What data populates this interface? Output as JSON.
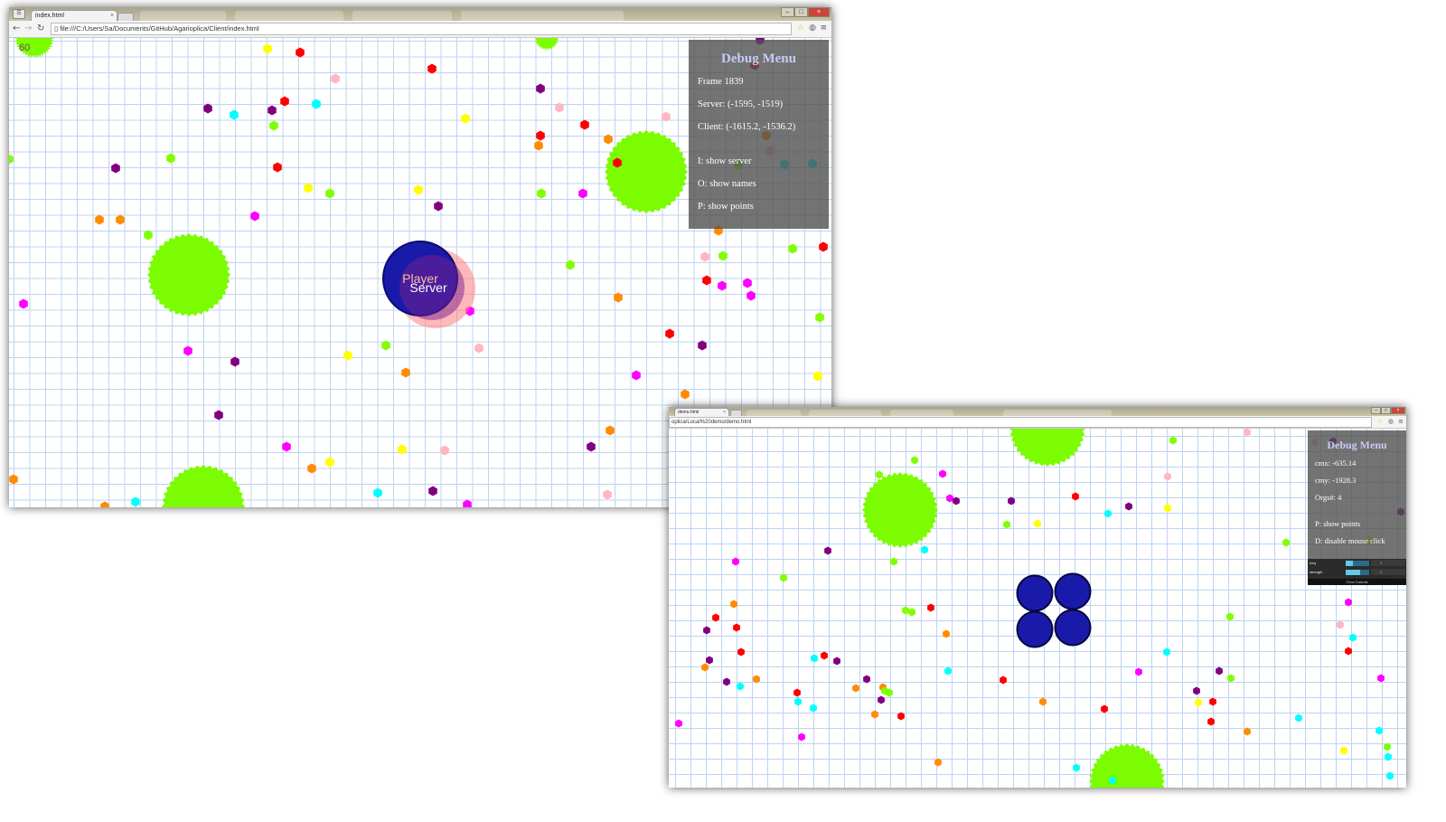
{
  "window_main": {
    "tab_title": "index.html",
    "url": "file:///C:/Users/Sa/Documents/GitHub/Agarioplica/Client/index.html",
    "fps": "60",
    "debug": {
      "title": "Debug Menu",
      "frame": "Frame 1839",
      "server": "Server: (-1595, -1519)",
      "client": "Client: (-1615.2, -1536.2)",
      "show_server": "I: show server",
      "show_names": "O: show names",
      "show_points": "P: show points"
    },
    "player_label": "Player",
    "server_label": "Server"
  },
  "window_demo": {
    "tab_title": "demo.html",
    "url": "oplica/Local%20demo/demo.html",
    "debug": {
      "title": "Debug Menu",
      "cmx": "cmx: -635.14",
      "cmy": "cmy: -1928.3",
      "orgs": "Orgs#: 4",
      "show_points": "P: show points",
      "disable_click": "D: disable mouse click"
    },
    "controls": {
      "freq_label": "freq",
      "freq_value": "1",
      "strength_label": "strength",
      "strength_value": "2",
      "close_label": "Close Controls"
    }
  },
  "colors": {
    "food_palette": [
      "#ff0000",
      "#7fff00",
      "#00ffff",
      "#ff00ff",
      "#ffff00",
      "#ff8c00",
      "#800080",
      "#ffb6c1"
    ],
    "virus": "#7cfc00",
    "player_cell": "#1a1aaa",
    "server_cell": "#ff8080",
    "grid": "#bcd4f3",
    "debug_title": "#c8cbf5"
  },
  "icons": {
    "back": "arrow-left-icon",
    "forward": "arrow-right-icon",
    "reload": "reload-icon",
    "page": "page-icon",
    "star": "star-icon",
    "extension": "extension-icon",
    "menu": "menu-icon"
  }
}
